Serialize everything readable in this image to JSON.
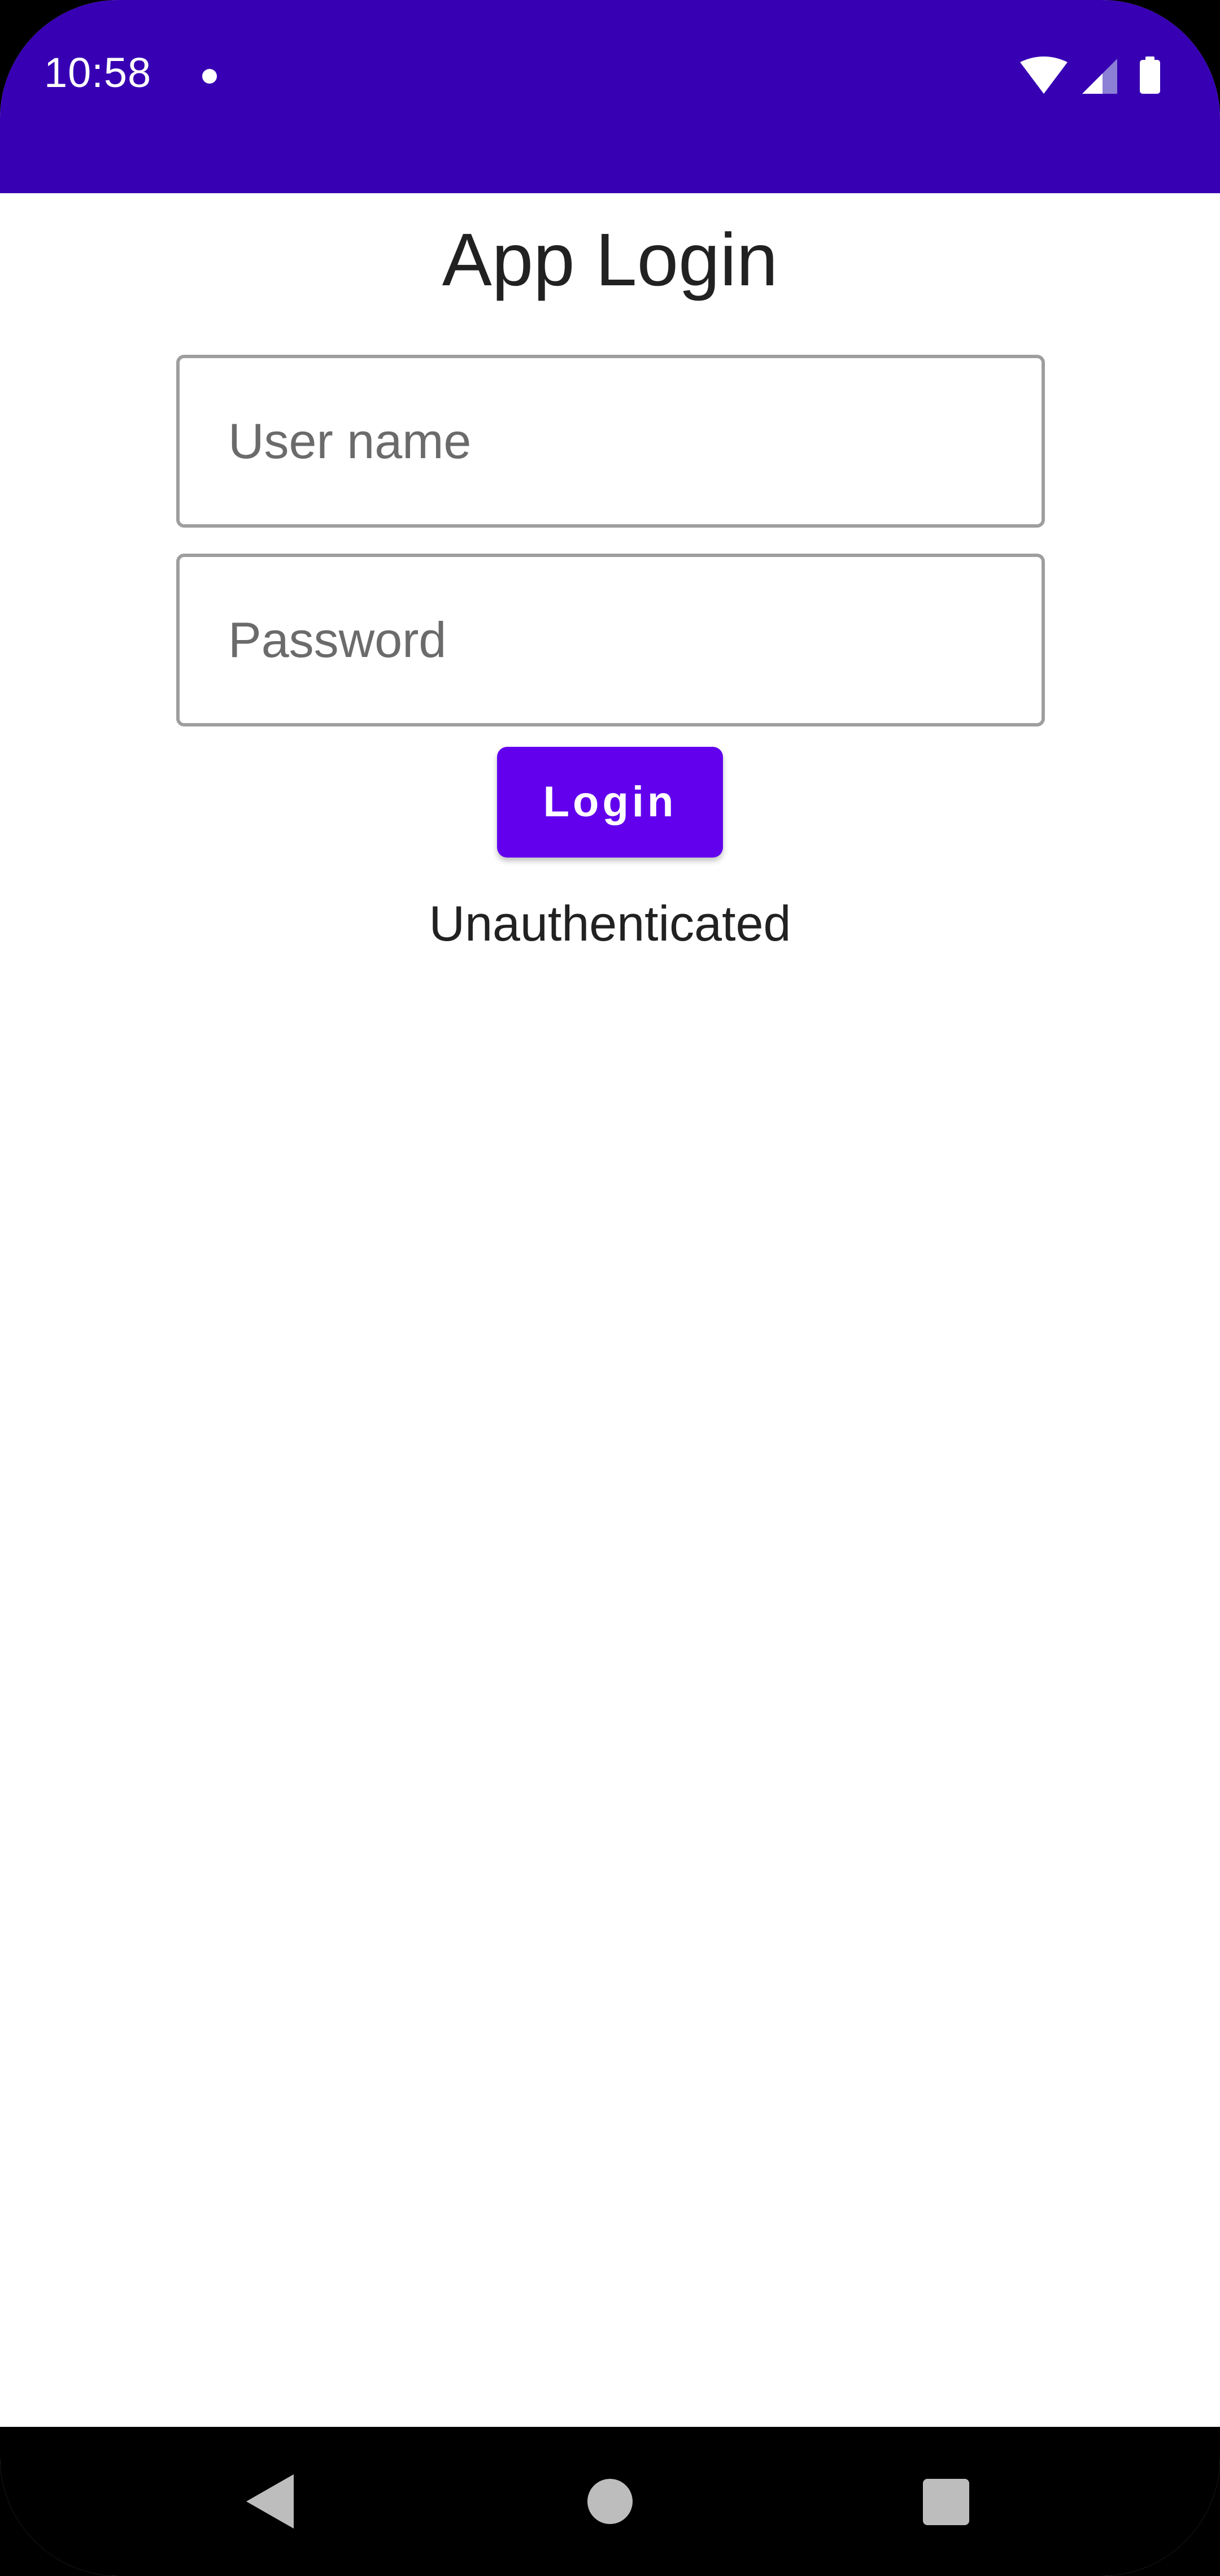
{
  "status_bar": {
    "time": "10:58",
    "icons": [
      "notification-dot-icon",
      "wifi-icon",
      "cellular-signal-icon",
      "battery-icon"
    ],
    "color": "#3700b3"
  },
  "app": {
    "title": "App Login",
    "username_field": {
      "placeholder": "User name",
      "value": ""
    },
    "password_field": {
      "placeholder": "Password",
      "value": ""
    },
    "login_button": {
      "label": "Login",
      "color": "#6200ee"
    },
    "auth_status": "Unauthenticated"
  },
  "nav_bar": {
    "icons": [
      "back-icon",
      "home-icon",
      "recents-icon"
    ]
  }
}
